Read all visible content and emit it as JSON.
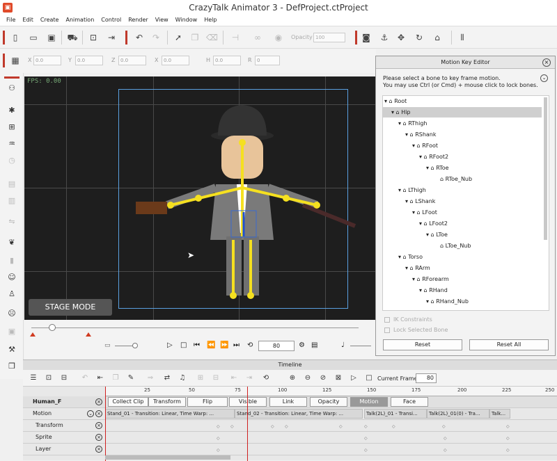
{
  "app": {
    "title": "CrazyTalk Animator 3   - DefProject.ctProject"
  },
  "menu": [
    "File",
    "Edit",
    "Create",
    "Animation",
    "Control",
    "Render",
    "View",
    "Window",
    "Help"
  ],
  "toolbar": {
    "opacity_label": "Opacity",
    "opacity_value": "100"
  },
  "transform": {
    "x_label": "X",
    "x_value": "0.0",
    "y_label": "Y",
    "y_value": "0.0",
    "z_label": "Z",
    "z_value": "0.0",
    "sx_label": "X",
    "sx_value": "0.0",
    "sy_label": "H",
    "sy_value": "0.0",
    "r_label": "R",
    "r_value": "0"
  },
  "stage": {
    "fps": "FPS: 0.00",
    "mode_label": "STAGE MODE"
  },
  "playback": {
    "frame_value": "80"
  },
  "motion_key_editor": {
    "title": "Motion Key Editor",
    "instruction1": "Please select a bone to key frame motion.",
    "instruction2": "You may use Ctrl (or Cmd) + mouse click to lock bones.",
    "tree": [
      {
        "label": "Root",
        "depth": 0,
        "selected": false
      },
      {
        "label": "Hip",
        "depth": 1,
        "selected": true
      },
      {
        "label": "RThigh",
        "depth": 2,
        "selected": false
      },
      {
        "label": "RShank",
        "depth": 3,
        "selected": false
      },
      {
        "label": "RFoot",
        "depth": 4,
        "selected": false
      },
      {
        "label": "RFoot2",
        "depth": 5,
        "selected": false
      },
      {
        "label": "RToe",
        "depth": 6,
        "selected": false
      },
      {
        "label": "RToe_Nub",
        "depth": 7,
        "selected": false
      },
      {
        "label": "LThigh",
        "depth": 2,
        "selected": false
      },
      {
        "label": "LShank",
        "depth": 3,
        "selected": false
      },
      {
        "label": "LFoot",
        "depth": 4,
        "selected": false
      },
      {
        "label": "LFoot2",
        "depth": 5,
        "selected": false
      },
      {
        "label": "LToe",
        "depth": 6,
        "selected": false
      },
      {
        "label": "LToe_Nub",
        "depth": 7,
        "selected": false
      },
      {
        "label": "Torso",
        "depth": 2,
        "selected": false
      },
      {
        "label": "RArm",
        "depth": 3,
        "selected": false
      },
      {
        "label": "RForearm",
        "depth": 4,
        "selected": false
      },
      {
        "label": "RHand",
        "depth": 5,
        "selected": false
      },
      {
        "label": "RHand_Nub",
        "depth": 6,
        "selected": false
      }
    ],
    "ik_constraints": "IK Constraints",
    "lock_selected": "Lock Selected Bone",
    "reset": "Reset",
    "reset_all": "Reset All"
  },
  "timeline": {
    "title": "Timeline",
    "current_frame_label": "Current Frame:",
    "current_frame_value": "80",
    "ruler": [
      "25",
      "50",
      "75",
      "100",
      "125",
      "150",
      "175",
      "200",
      "225",
      "250"
    ],
    "actor": "Human_F",
    "categories": [
      "Collect Clip",
      "Transform",
      "Flip",
      "Visible",
      "Link",
      "Opacity",
      "Motion",
      "Face"
    ],
    "active_category": "Motion",
    "tracks": [
      "Motion",
      "Transform",
      "Sprite",
      "Layer"
    ],
    "clips": [
      "Stand_01 - Transition: Linear, Time Warp: ...",
      "Stand_02 - Transition: Linear, Time Warp: ...",
      "Talk(2L)_01 - Transi...",
      "Talk(2L)_01(0) - Tra...",
      "Talk..."
    ]
  }
}
